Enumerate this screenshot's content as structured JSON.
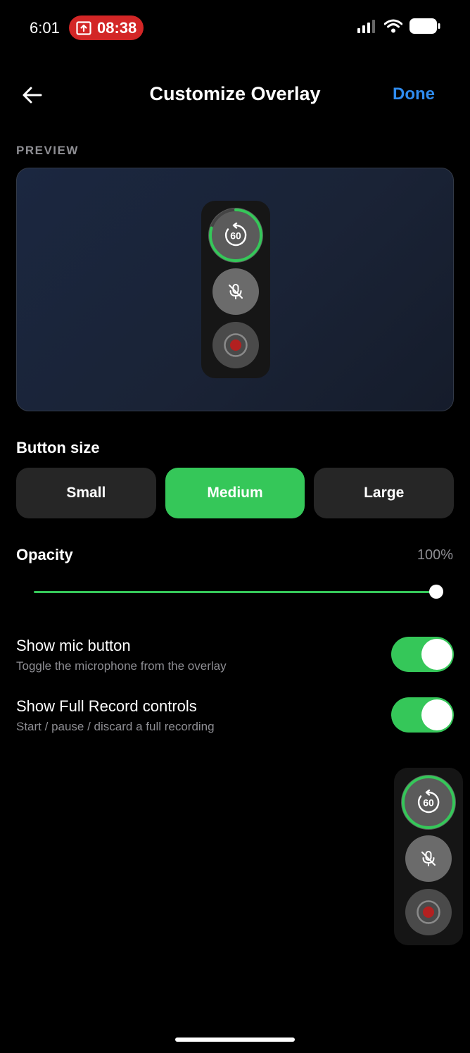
{
  "status_bar": {
    "time": "6:01",
    "recording_timer": "08:38",
    "recording_pill_color": "#d32626",
    "icons": [
      "upload-icon",
      "cellular-signal-icon",
      "wifi-icon",
      "battery-icon"
    ]
  },
  "header": {
    "title": "Customize Overlay",
    "done_label": "Done",
    "back_icon": "arrow-left-icon",
    "done_color": "#2f8cf0"
  },
  "preview": {
    "section_label": "PREVIEW",
    "replay_seconds": "60",
    "buttons": [
      "replay-60-icon",
      "mic-off-icon",
      "record-icon"
    ]
  },
  "button_size": {
    "label": "Button size",
    "options": [
      {
        "label": "Small",
        "selected": false
      },
      {
        "label": "Medium",
        "selected": true
      },
      {
        "label": "Large",
        "selected": false
      }
    ],
    "selected_color": "#35c759"
  },
  "opacity": {
    "label": "Opacity",
    "value_text": "100%",
    "value": 100,
    "min": 0,
    "max": 100
  },
  "toggles": [
    {
      "title": "Show mic button",
      "subtitle": "Toggle the microphone from the overlay",
      "on": true
    },
    {
      "title": "Show Full Record controls",
      "subtitle": "Start / pause / discard a full recording",
      "on": true
    }
  ],
  "floating_overlay": {
    "replay_seconds": "60",
    "buttons": [
      "replay-60-icon",
      "mic-off-icon",
      "record-icon"
    ]
  },
  "colors": {
    "accent_green": "#35c759",
    "record_red": "#b32020"
  }
}
